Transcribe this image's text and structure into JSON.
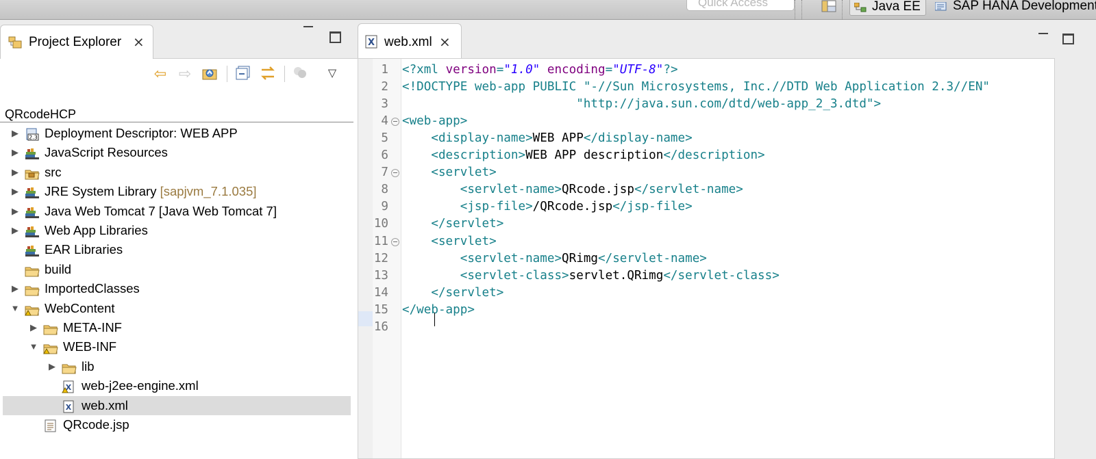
{
  "toolbar": {
    "quick_access_placeholder": "Quick Access",
    "perspectives": [
      {
        "label": "Java EE",
        "icon": "java-ee-perspective-icon",
        "active": true
      },
      {
        "label": "SAP HANA Development",
        "icon": "sap-hana-perspective-icon",
        "active": false
      }
    ]
  },
  "project_explorer": {
    "tab_label": "Project Explorer",
    "root": "QRcodeHCP",
    "items": [
      {
        "label": "Deployment Descriptor: WEB APP",
        "decoration": "",
        "expand": "collapsed",
        "icon": "deployment-descriptor-icon",
        "depth": 0
      },
      {
        "label": "JavaScript Resources",
        "decoration": "",
        "expand": "collapsed",
        "icon": "library-icon",
        "depth": 0
      },
      {
        "label": "src",
        "decoration": "",
        "expand": "collapsed",
        "icon": "package-folder-icon",
        "depth": 0
      },
      {
        "label": "JRE System Library ",
        "decoration": "[sapjvm_7.1.035]",
        "expand": "collapsed",
        "icon": "library-icon",
        "depth": 0
      },
      {
        "label": "Java Web Tomcat 7 [Java Web Tomcat 7]",
        "decoration": "",
        "expand": "collapsed",
        "icon": "library-icon",
        "depth": 0
      },
      {
        "label": "Web App Libraries",
        "decoration": "",
        "expand": "collapsed",
        "icon": "library-icon",
        "depth": 0
      },
      {
        "label": "EAR Libraries",
        "decoration": "",
        "expand": "none",
        "icon": "library-icon",
        "depth": 0
      },
      {
        "label": "build",
        "decoration": "",
        "expand": "none",
        "icon": "folder-icon",
        "depth": 0
      },
      {
        "label": "ImportedClasses",
        "decoration": "",
        "expand": "collapsed",
        "icon": "folder-icon",
        "depth": 0
      },
      {
        "label": "WebContent",
        "decoration": "",
        "expand": "expanded",
        "icon": "folder-warning-icon",
        "depth": 0
      },
      {
        "label": "META-INF",
        "decoration": "",
        "expand": "collapsed",
        "icon": "folder-icon",
        "depth": 1
      },
      {
        "label": "WEB-INF",
        "decoration": "",
        "expand": "expanded",
        "icon": "folder-warning-icon",
        "depth": 1
      },
      {
        "label": "lib",
        "decoration": "",
        "expand": "collapsed",
        "icon": "folder-icon",
        "depth": 2
      },
      {
        "label": "web-j2ee-engine.xml",
        "decoration": "",
        "expand": "none",
        "icon": "xml-file-warning-icon",
        "depth": 2
      },
      {
        "label": "web.xml",
        "decoration": "",
        "expand": "none",
        "icon": "xml-file-icon",
        "depth": 2,
        "selected": true
      },
      {
        "label": "QRcode.jsp",
        "decoration": "",
        "expand": "none",
        "icon": "jsp-file-icon",
        "depth": 1
      }
    ]
  },
  "editor": {
    "tab_label": "web.xml",
    "lines": [
      {
        "n": "1",
        "fold": false,
        "parts": [
          [
            "t",
            "<?xml "
          ],
          [
            "a",
            "version"
          ],
          [
            "t",
            "="
          ],
          [
            "v",
            "\"1.0\""
          ],
          [
            "t",
            " "
          ],
          [
            "a",
            "encoding"
          ],
          [
            "t",
            "="
          ],
          [
            "v",
            "\"UTF-8\""
          ],
          [
            "t",
            "?>"
          ]
        ]
      },
      {
        "n": "2",
        "fold": false,
        "parts": [
          [
            "t",
            "<!DOCTYPE web-app "
          ],
          [
            "d",
            "PUBLIC "
          ],
          [
            "s",
            "\"-//Sun Microsystems, Inc.//DTD Web Application 2.3//EN\""
          ]
        ]
      },
      {
        "n": "3",
        "fold": false,
        "parts": [
          [
            "s",
            "                        \"http://java.sun.com/dtd/web-app_2_3.dtd\">"
          ]
        ]
      },
      {
        "n": "4",
        "fold": true,
        "parts": [
          [
            "t",
            "<web-app>"
          ]
        ]
      },
      {
        "n": "5",
        "fold": false,
        "parts": [
          [
            "t",
            "    <display-name>"
          ],
          [
            "x",
            "WEB APP"
          ],
          [
            "t",
            "</display-name>"
          ]
        ]
      },
      {
        "n": "6",
        "fold": false,
        "parts": [
          [
            "t",
            "    <description>"
          ],
          [
            "x",
            "WEB APP description"
          ],
          [
            "t",
            "</description>"
          ]
        ]
      },
      {
        "n": "7",
        "fold": true,
        "parts": [
          [
            "t",
            "    <servlet>"
          ]
        ]
      },
      {
        "n": "8",
        "fold": false,
        "parts": [
          [
            "t",
            "        <servlet-name>"
          ],
          [
            "x",
            "QRcode.jsp"
          ],
          [
            "t",
            "</servlet-name>"
          ]
        ]
      },
      {
        "n": "9",
        "fold": false,
        "parts": [
          [
            "t",
            "        <jsp-file>"
          ],
          [
            "x",
            "/QRcode.jsp"
          ],
          [
            "t",
            "</jsp-file>"
          ]
        ]
      },
      {
        "n": "10",
        "fold": false,
        "parts": [
          [
            "t",
            "    </servlet>"
          ]
        ]
      },
      {
        "n": "11",
        "fold": true,
        "parts": [
          [
            "t",
            "    <servlet>"
          ]
        ]
      },
      {
        "n": "12",
        "fold": false,
        "parts": [
          [
            "t",
            "        <servlet-name>"
          ],
          [
            "x",
            "QRimg"
          ],
          [
            "t",
            "</servlet-name>"
          ]
        ]
      },
      {
        "n": "13",
        "fold": false,
        "parts": [
          [
            "t",
            "        <servlet-class>"
          ],
          [
            "x",
            "servlet.QRimg"
          ],
          [
            "t",
            "</servlet-class>"
          ]
        ]
      },
      {
        "n": "14",
        "fold": false,
        "parts": [
          [
            "t",
            "    </servlet>"
          ]
        ]
      },
      {
        "n": "15",
        "fold": false,
        "parts": [
          [
            "t",
            "</web-app>"
          ]
        ]
      },
      {
        "n": "16",
        "fold": false,
        "parts": []
      }
    ]
  },
  "colors": {
    "tag": "#17808a",
    "attribute": "#7f007f",
    "value": "#2a00ff",
    "selection": "#dcdcdc"
  }
}
